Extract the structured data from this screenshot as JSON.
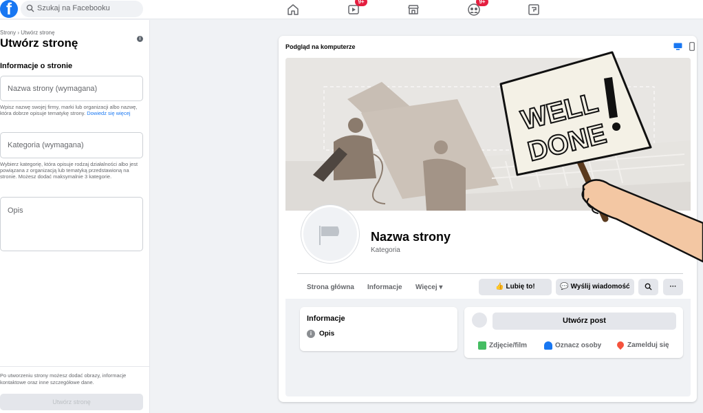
{
  "topbar": {
    "logo_letter": "f",
    "search_placeholder": "Szukaj na Facebooku",
    "badges": [
      "9+",
      "9+"
    ]
  },
  "left": {
    "breadcrumb": "Strony › Utwórz stronę",
    "title": "Utwórz stronę",
    "info_dot": "i",
    "section_heading": "Informacje o stronie",
    "name_placeholder": "Nazwa strony (wymagana)",
    "name_help": "Wpisz nazwę swojej firmy, marki lub organizacji albo nazwę, która dobrze opisuje tematykę strony.",
    "learn_more": "Dowiedz się więcej",
    "category_placeholder": "Kategoria (wymagana)",
    "category_help": "Wybierz kategorię, która opisuje rodzaj działalności albo jest powiązana z organizacją lub tematyką przedstawioną na stronie. Możesz dodać maksymalnie 3 kategorie.",
    "description_placeholder": "Opis",
    "footer_note": "Po utworzeniu strony możesz dodać obrazy, informacje kontaktowe oraz inne szczegółowe dane.",
    "create_button": "Utwórz stronę"
  },
  "preview": {
    "label": "Podgląd na komputerze",
    "page_name": "Nazwa strony",
    "page_category": "Kategoria",
    "tabs": [
      "Strona główna",
      "Informacje",
      "Więcej ▾"
    ],
    "buttons": {
      "like": "Lubię to!",
      "message": "Wyślij wiadomość",
      "more": "···"
    },
    "info_card": {
      "heading": "Informacje",
      "opis": "Opis"
    },
    "post_card": {
      "create_post": "Utwórz post",
      "photo": "Zdjęcie/film",
      "tag": "Oznacz osoby",
      "checkin": "Zamelduj się"
    }
  },
  "overlay": {
    "sign_text_line1": "WELL",
    "sign_text_line2": "DONE"
  },
  "colors": {
    "brand": "#1877f2",
    "badge": "#e41e3f",
    "photo_green": "#45bd62",
    "tag_blue": "#1877f2",
    "checkin_red": "#f5533d"
  }
}
